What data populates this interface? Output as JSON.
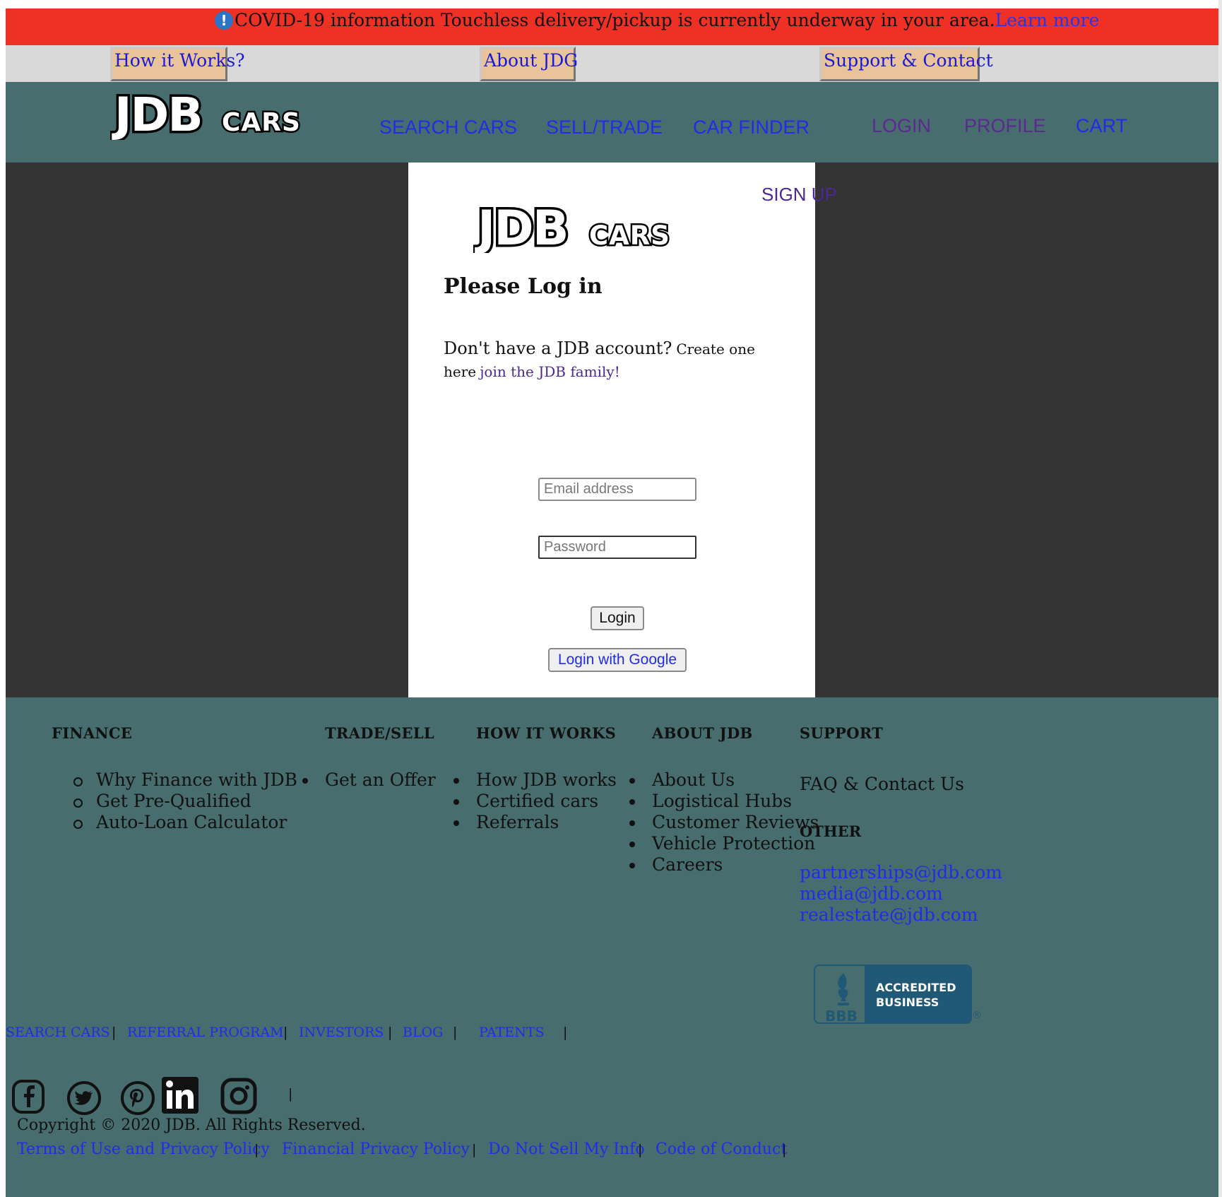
{
  "banner": {
    "text": "COVID-19 information Touchless delivery/pickup is currently underway in your area.",
    "link": "Learn more"
  },
  "quicknav": {
    "how": "How it Works?",
    "about": "About JDG",
    "support": "Support & Contact"
  },
  "header": {
    "logo_main": "JDB",
    "logo_sub": "CARS",
    "nav": {
      "search": "SEARCH CARS",
      "sell": "SELL/TRADE",
      "finder": "CAR FINDER",
      "login": "LOGIN",
      "profile": "PROFILE",
      "cart": "CART"
    }
  },
  "login": {
    "signup": "SIGN UP",
    "title": "Please Log in",
    "question": "Don't have a JDB account?",
    "create": "Create one",
    "here": "here",
    "join": "join the JDB family!",
    "email_placeholder": "Email address",
    "password_placeholder": "Password",
    "login_button": "Login",
    "google_button": "Login with Google"
  },
  "footer": {
    "finance": {
      "heading": "FINANCE",
      "items": [
        "Why Finance with JDB",
        "Get Pre-Qualified",
        "Auto-Loan Calculator"
      ]
    },
    "trade": {
      "heading": "TRADE/SELL",
      "items": [
        "Get an Offer"
      ]
    },
    "how": {
      "heading": "HOW IT WORKS",
      "items": [
        "How JDB works",
        "Certified cars",
        "Referrals"
      ]
    },
    "about": {
      "heading": "ABOUT JDB",
      "items": [
        "About Us",
        "Logistical Hubs",
        "Customer Reviews",
        "Vehicle Protection",
        "Careers"
      ]
    },
    "support": {
      "heading": "SUPPORT",
      "faq": "FAQ & Contact Us",
      "other_heading": "OTHER",
      "emails": [
        "partnerships@jdb.com",
        "media@jdb.com",
        "realestate@jdb.com"
      ]
    },
    "bbb": {
      "line1": "ACCREDITED",
      "line2": "BUSINESS",
      "mark": "BBB",
      "registered": "®"
    },
    "bottom_links": [
      "SEARCH CARS",
      "REFERRAL PROGRAM",
      "INVESTORS",
      "BLOG",
      "PATENTS"
    ],
    "separator": "|",
    "social": [
      "facebook-icon",
      "twitter-icon",
      "pinterest-icon",
      "linkedin-icon",
      "instagram-icon"
    ],
    "copyright": "Copyright © 2020 JDB. All Rights Reserved.",
    "legal_links": [
      "Terms of Use and Privacy Policy",
      "Financial Privacy Policy",
      "Do Not Sell My Info",
      "Code of Conduct"
    ]
  }
}
